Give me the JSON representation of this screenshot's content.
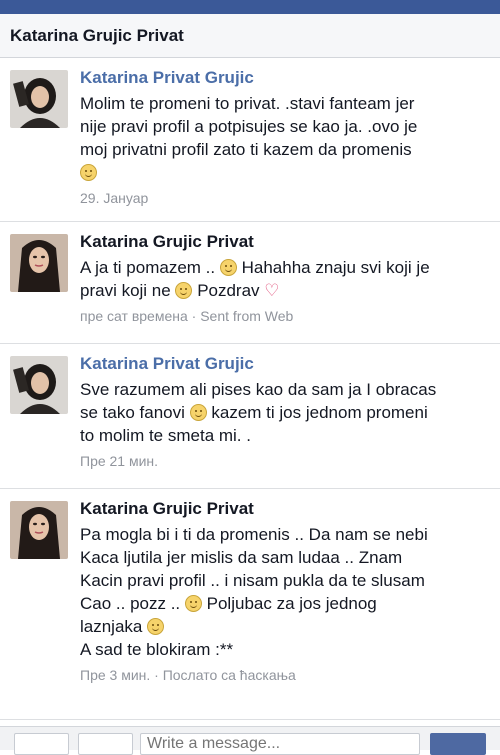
{
  "header": {
    "title": "Katarina Grujic Privat"
  },
  "messages": [
    {
      "sender": "Katarina Privat Grujic",
      "lines": [
        "Molim te promeni to privat. .stavi fanteam jer",
        "nije pravi profil a potpisujes se kao ja. .ovo je",
        "moj privatni profil zato ti kazem da promenis"
      ],
      "meta": "29. Јануар"
    },
    {
      "sender": "Katarina Grujic Privat",
      "line1_a": "A ja ti pomazem ..",
      "line1_b": "Hahahha znaju svi koji je",
      "line2_a": "pravi koji ne",
      "line2_b": "Pozdrav",
      "meta": "пре сат времена · Sent from Web"
    },
    {
      "sender": "Katarina Privat Grujic",
      "line1": "Sve razumem ali pises kao da sam ja I obracas",
      "line2_a": "se tako fanovi",
      "line2_b": "kazem ti jos jednom promeni",
      "line3": "to molim te smeta mi. .",
      "meta": "Пре 21 мин."
    },
    {
      "sender": "Katarina Grujic Privat",
      "line1": "Pa mogla bi i ti da promenis .. Da nam se nebi",
      "line2": "Kaca ljutila jer mislis da sam ludaa .. Znam",
      "line3": "Kacin pravi profil .. i nisam pukla da te slusam",
      "line4_a": "Cao .. pozz ..",
      "line4_b": "Poljubac za jos jednog",
      "line5": "laznjaka",
      "line6": "A sad te blokiram :**",
      "meta": "Пре 3 мин. · Послато са ћаскања"
    }
  ],
  "composer": {
    "placeholder": "Write a message..."
  },
  "colors": {
    "brand": "#3b5998",
    "sender_link": "#4b6ea8",
    "meta": "#90949c"
  }
}
